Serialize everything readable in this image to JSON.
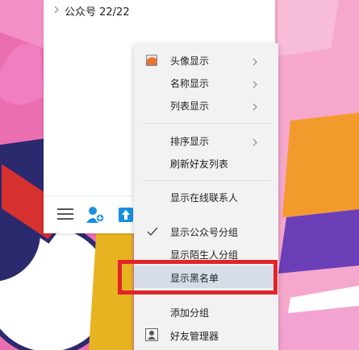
{
  "contact_group": {
    "label": "公众号 22/22"
  },
  "menu": {
    "items": [
      {
        "label": "头像显示",
        "has_submenu": true,
        "icon": "avatar-display-icon"
      },
      {
        "label": "名称显示",
        "has_submenu": true
      },
      {
        "label": "列表显示",
        "has_submenu": true
      },
      {
        "label": "排序显示",
        "has_submenu": true
      },
      {
        "label": "刷新好友列表"
      },
      {
        "label": "显示在线联系人"
      },
      {
        "label": "显示公众号分组",
        "checked": true
      },
      {
        "label": "显示陌生人分组"
      },
      {
        "label": "显示黑名单",
        "highlighted": true
      },
      {
        "label": "添加分组"
      },
      {
        "label": "好友管理器",
        "icon": "friend-manager-icon"
      }
    ]
  },
  "colors": {
    "highlight_box": "#e0242a",
    "menu_bg": "#f2f2f2",
    "hover": "#d6dde9",
    "accent_blue": "#1a8fe0"
  },
  "bottom_bar": {
    "icons": [
      "menu-icon",
      "add-contact-icon",
      "app-store-icon"
    ]
  }
}
